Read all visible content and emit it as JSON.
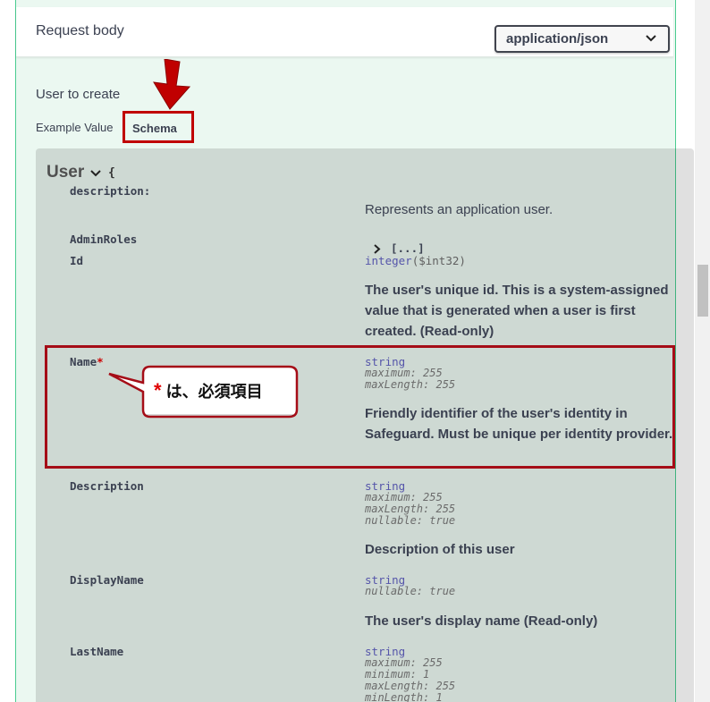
{
  "request_body": {
    "title": "Request body",
    "content_type": "application/json"
  },
  "body_description": "User to create",
  "tabs": {
    "example_value": "Example Value",
    "schema": "Schema"
  },
  "model": {
    "name": "User",
    "open_brace": "{",
    "description_key": "description:",
    "description_value": "Represents an application user.",
    "properties": [
      {
        "name": "AdminRoles",
        "collapsed": "[...]"
      },
      {
        "name": "Id",
        "type": "integer",
        "format": "($int32)",
        "description": "The user's unique id. This is a system-assigned value that is generated when a user is first created. (Read-only)"
      },
      {
        "name": "Name",
        "required_mark": "*",
        "type": "string",
        "meta": [
          "maximum: 255",
          "maxLength: 255"
        ],
        "description": "Friendly identifier of the user's identity in Safeguard. Must be unique per identity provider."
      },
      {
        "name": "Description",
        "type": "string",
        "meta": [
          "maximum: 255",
          "maxLength: 255",
          "nullable: true"
        ],
        "description": "Description of this user"
      },
      {
        "name": "DisplayName",
        "type": "string",
        "meta": [
          "nullable: true"
        ],
        "description": "The user's display name (Read-only)"
      },
      {
        "name": "LastName",
        "type": "string",
        "meta": [
          "maximum: 255",
          "minimum: 1",
          "maxLength: 255",
          "minLength: 1"
        ]
      }
    ]
  },
  "annotation": {
    "star": "*",
    "text": " は、必須項目"
  },
  "colors": {
    "accent_green": "#49cc90",
    "panel_bg": "#ebf8f1",
    "highlight_red": "#c00000"
  }
}
